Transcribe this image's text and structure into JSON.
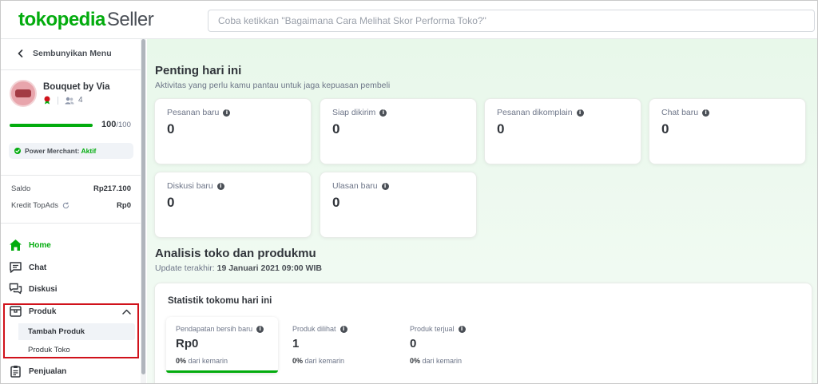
{
  "header": {
    "logo_brand": "tokopedia",
    "logo_suffix": "Seller",
    "search_placeholder": "Coba ketikkan \"Bagaimana Cara Melihat Skor Performa Toko?\""
  },
  "sidebar": {
    "hide_menu": "Sembunyikan Menu",
    "shop": {
      "name": "Bouquet by Via",
      "followers": "4",
      "score": "100",
      "score_max": "/100",
      "score_fraction": 1.0
    },
    "power_merchant": {
      "label": "Power Merchant:",
      "status": "Aktif"
    },
    "balance": [
      {
        "label": "Saldo",
        "value": "Rp217.100"
      },
      {
        "label": "Kredit TopAds",
        "value": "Rp0"
      }
    ],
    "nav": {
      "home": "Home",
      "chat": "Chat",
      "diskusi": "Diskusi",
      "produk": "Produk",
      "tambah_produk": "Tambah Produk",
      "produk_toko": "Produk Toko",
      "penjualan": "Penjualan"
    }
  },
  "main": {
    "penting": {
      "title": "Penting hari ini",
      "subtitle": "Aktivitas yang perlu kamu pantau untuk jaga kepuasan pembeli",
      "cards": [
        {
          "label": "Pesanan baru",
          "value": "0"
        },
        {
          "label": "Siap dikirim",
          "value": "0"
        },
        {
          "label": "Pesanan dikomplain",
          "value": "0"
        },
        {
          "label": "Chat baru",
          "value": "0"
        },
        {
          "label": "Diskusi baru",
          "value": "0"
        },
        {
          "label": "Ulasan baru",
          "value": "0"
        }
      ]
    },
    "analisis": {
      "title": "Analisis toko dan produkmu",
      "updated_label": "Update terakhir:",
      "updated_value": "19 Januari 2021 09:00 WIB",
      "panel_title": "Statistik tokomu hari ini",
      "stats": [
        {
          "label": "Pendapatan bersih baru",
          "value": "Rp0",
          "change": "0%",
          "change_suffix": "dari kemarin"
        },
        {
          "label": "Produk dilihat",
          "value": "1",
          "change": "0%",
          "change_suffix": "dari kemarin"
        },
        {
          "label": "Produk terjual",
          "value": "0",
          "change": "0%",
          "change_suffix": "dari kemarin"
        }
      ]
    }
  },
  "colors": {
    "brand_green": "#03ac0e",
    "highlight_red": "#d0121b"
  }
}
